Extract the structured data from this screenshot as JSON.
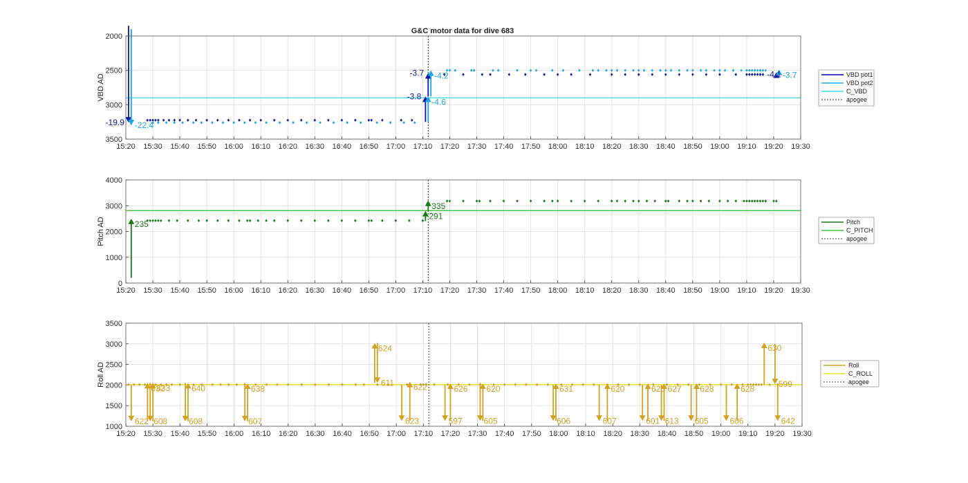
{
  "title": "G&C motor data for dive 683",
  "chart_data": [
    {
      "type": "line",
      "ylabel": "VBD AD",
      "ylim": [
        2000,
        3500
      ],
      "y_reversed": true,
      "yticks": [
        2000,
        2500,
        3000,
        3500
      ],
      "xlim": [
        "15:20",
        "19:30"
      ],
      "xtick_labels": [
        "15:20",
        "15:30",
        "15:40",
        "15:50",
        "16:00",
        "16:10",
        "16:20",
        "16:30",
        "16:40",
        "16:50",
        "17:00",
        "17:10",
        "17:20",
        "17:30",
        "17:40",
        "17:50",
        "18:00",
        "18:10",
        "18:20",
        "18:30",
        "18:40",
        "18:50",
        "19:00",
        "19:10",
        "19:20",
        "19:30"
      ],
      "apogee": "17:12",
      "grid": true,
      "legend": {
        "placement": "right",
        "entries": [
          {
            "label": "VBD pot1",
            "color": "#0000aa",
            "style": "solid"
          },
          {
            "label": "VBD pot2",
            "color": "#1ba6e0",
            "style": "solid"
          },
          {
            "label": "C_VBD",
            "color": "#40d8e8",
            "style": "solid"
          },
          {
            "label": "apogee",
            "color": "#333333",
            "style": "dotted"
          }
        ]
      },
      "reference_line": {
        "name": "C_VBD",
        "value": 2900,
        "color": "#40d8e8"
      },
      "series": [
        {
          "name": "VBD pot1",
          "color": "#0a1aa8",
          "y": 3225,
          "x": [
            "15:28",
            "15:29",
            "15:30",
            "15:31",
            "15:32",
            "15:34",
            "15:36",
            "15:38",
            "15:40",
            "15:43",
            "15:46",
            "15:50",
            "15:54",
            "15:58",
            "16:02",
            "16:06",
            "16:10",
            "16:15",
            "16:20",
            "16:25",
            "16:30",
            "16:35",
            "16:40",
            "16:45",
            "16:50",
            "16:51",
            "16:55",
            "17:02",
            "17:06"
          ]
        },
        {
          "name": "VBD pot2",
          "color": "#1ba6e0",
          "y": 3260,
          "x": [
            "15:30",
            "15:32",
            "15:35",
            "15:38",
            "15:41",
            "15:45",
            "15:48",
            "15:52",
            "15:56",
            "16:00",
            "16:04",
            "16:08",
            "16:12",
            "16:17",
            "16:22",
            "16:27",
            "16:32",
            "16:37",
            "16:42",
            "16:47",
            "16:53",
            "16:58",
            "17:03",
            "17:07"
          ]
        },
        {
          "name": "VBD pot1",
          "color": "#0a1aa8",
          "y": 2560,
          "x": [
            "17:18",
            "17:25",
            "17:32",
            "17:35",
            "17:42",
            "17:48",
            "17:55",
            "18:00",
            "18:05",
            "18:12",
            "18:20",
            "18:25",
            "18:30",
            "18:35",
            "18:40",
            "18:45",
            "18:50",
            "18:55",
            "19:00",
            "19:06",
            "19:10",
            "19:11",
            "19:12",
            "19:13",
            "19:14",
            "19:15",
            "19:16",
            "19:21"
          ]
        },
        {
          "name": "VBD pot2",
          "color": "#1ba6e0",
          "y": 2500,
          "x": [
            "17:19",
            "17:20",
            "17:22",
            "17:28",
            "17:29",
            "17:36",
            "17:38",
            "17:45",
            "17:50",
            "17:52",
            "17:58",
            "18:02",
            "18:08",
            "18:13",
            "18:15",
            "18:18",
            "18:20",
            "18:22",
            "18:25",
            "18:28",
            "18:30",
            "18:32",
            "18:35",
            "18:38",
            "18:40",
            "18:42",
            "18:45",
            "18:48",
            "18:50",
            "18:53",
            "18:55",
            "18:58",
            "19:00",
            "19:02",
            "19:05",
            "19:08",
            "19:10",
            "19:11",
            "19:12",
            "19:13",
            "19:14",
            "19:15",
            "19:16",
            "19:17"
          ]
        }
      ],
      "events": [
        {
          "series": "VBD pot1",
          "x": "15:21",
          "from": 1850,
          "to": 3260,
          "label": "-19.9",
          "color": "#0a1aa8"
        },
        {
          "series": "VBD pot2",
          "x": "15:22",
          "from": 1900,
          "to": 3300,
          "label": "-22.4",
          "color": "#1ba6e0"
        },
        {
          "series": "VBD pot1",
          "x": "17:11",
          "from": 3250,
          "to": 2880,
          "label": "-3.8",
          "color": "#0a1aa8"
        },
        {
          "series": "VBD pot2",
          "x": "17:12",
          "from": 3250,
          "to": 2880,
          "label": "-4.6",
          "color": "#1ba6e0"
        },
        {
          "series": "VBD pot1",
          "x": "17:12",
          "from": 2880,
          "to": 2540,
          "label": "-3.7",
          "color": "#0a1aa8"
        },
        {
          "series": "VBD pot2",
          "x": "17:13",
          "from": 2880,
          "to": 2500,
          "label": "-4.2",
          "color": "#1ba6e0"
        },
        {
          "series": "VBD pot1",
          "x": "19:21",
          "from": 2560,
          "to": 2530,
          "label": "",
          "color": "#0a1aa8"
        },
        {
          "series": "VBD pot2",
          "x": "19:22",
          "from": 2560,
          "to": 2490,
          "label": "-3.7",
          "color": "#1ba6e0"
        }
      ],
      "extra_labels": [
        {
          "x": "19:17",
          "y": 2560,
          "text": "-4.1",
          "color": "#0a1aa8"
        }
      ]
    },
    {
      "type": "line",
      "ylabel": "Pitch AD",
      "ylim": [
        0,
        4000
      ],
      "y_reversed": false,
      "yticks": [
        0,
        1000,
        2000,
        3000,
        4000
      ],
      "xlim": [
        "15:20",
        "19:30"
      ],
      "xtick_labels": [
        "15:20",
        "15:30",
        "15:40",
        "15:50",
        "16:00",
        "16:10",
        "16:20",
        "16:30",
        "16:40",
        "16:50",
        "17:00",
        "17:10",
        "17:20",
        "17:30",
        "17:40",
        "17:50",
        "18:00",
        "18:10",
        "18:20",
        "18:30",
        "18:40",
        "18:50",
        "19:00",
        "19:10",
        "19:20",
        "19:30"
      ],
      "apogee": "17:12",
      "grid": true,
      "legend": {
        "placement": "right",
        "entries": [
          {
            "label": "Pitch",
            "color": "#1a7a1a",
            "style": "solid"
          },
          {
            "label": "C_PITCH",
            "color": "#3cc43c",
            "style": "solid"
          },
          {
            "label": "apogee",
            "color": "#333333",
            "style": "dotted"
          }
        ]
      },
      "reference_line": {
        "name": "C_PITCH",
        "value": 2810,
        "color": "#3cc43c"
      },
      "series": [
        {
          "name": "Pitch",
          "color": "#1a7a1a",
          "y": 2420,
          "x": [
            "15:28",
            "15:29",
            "15:30",
            "15:31",
            "15:32",
            "15:33",
            "15:36",
            "15:39",
            "15:43",
            "15:47",
            "15:50",
            "15:54",
            "15:58",
            "16:02",
            "16:05",
            "16:06",
            "16:09",
            "16:12",
            "16:15",
            "16:20",
            "16:25",
            "16:30",
            "16:35",
            "16:40",
            "16:45",
            "16:50",
            "16:51",
            "16:55",
            "17:00",
            "17:05",
            "17:10"
          ]
        },
        {
          "name": "Pitch",
          "color": "#1a7a1a",
          "y": 3180,
          "x": [
            "17:19",
            "17:20",
            "17:25",
            "17:30",
            "17:31",
            "17:35",
            "17:40",
            "17:45",
            "17:50",
            "17:55",
            "17:58",
            "18:00",
            "18:05",
            "18:10",
            "18:15",
            "18:20",
            "18:22",
            "18:25",
            "18:28",
            "18:30",
            "18:33",
            "18:36",
            "18:40",
            "18:41",
            "18:45",
            "18:48",
            "18:50",
            "18:53",
            "18:56",
            "19:00",
            "19:03",
            "19:06",
            "19:09",
            "19:10",
            "19:11",
            "19:12",
            "19:13",
            "19:14",
            "19:15",
            "19:16",
            "19:17",
            "19:20",
            "19:21"
          ]
        }
      ],
      "events": [
        {
          "x": "15:22",
          "from": 200,
          "to": 2500,
          "label": "235",
          "color": "#1a7a1a"
        },
        {
          "x": "17:11",
          "from": 2400,
          "to": 2800,
          "label": "291",
          "color": "#1a7a1a"
        },
        {
          "x": "17:12",
          "from": 2800,
          "to": 3200,
          "label": "335",
          "color": "#1a7a1a"
        }
      ]
    },
    {
      "type": "line",
      "ylabel": "Roll AD",
      "ylim": [
        1000,
        3500
      ],
      "y_reversed": false,
      "yticks": [
        1000,
        1500,
        2000,
        2500,
        3000,
        3500
      ],
      "xlim": [
        "15:20",
        "19:30"
      ],
      "xtick_labels": [
        "15:20",
        "15:30",
        "15:40",
        "15:50",
        "16:00",
        "16:10",
        "16:20",
        "16:30",
        "16:40",
        "16:50",
        "17:00",
        "17:10",
        "17:20",
        "17:30",
        "17:40",
        "17:50",
        "18:00",
        "18:10",
        "18:20",
        "18:30",
        "18:40",
        "18:50",
        "19:00",
        "19:10",
        "19:20",
        "19:30"
      ],
      "apogee": "17:12",
      "grid": true,
      "legend": {
        "placement": "right",
        "entries": [
          {
            "label": "Roll",
            "color": "#d4a020",
            "style": "solid"
          },
          {
            "label": "C_ROLL",
            "color": "#f0e020",
            "style": "solid"
          },
          {
            "label": "apogee",
            "color": "#333333",
            "style": "dotted"
          }
        ]
      },
      "reference_line": {
        "name": "C_ROLL",
        "value": 2010,
        "color": "#f0e020"
      },
      "series": [
        {
          "name": "Roll",
          "color": "#c8a030",
          "y": 2010,
          "x": [
            "15:21",
            "15:23",
            "15:25",
            "15:27",
            "15:29",
            "15:31",
            "15:33",
            "15:35",
            "15:37",
            "15:40",
            "15:45",
            "15:48",
            "15:52",
            "15:55",
            "15:58",
            "16:01",
            "16:04",
            "16:08",
            "16:12",
            "16:16",
            "16:20",
            "16:25",
            "16:30",
            "16:35",
            "16:40",
            "16:45",
            "16:48",
            "16:53",
            "16:57",
            "17:04",
            "17:09",
            "17:10",
            "17:11",
            "17:14",
            "17:19",
            "17:23",
            "17:27",
            "17:31",
            "17:36",
            "17:40",
            "17:44",
            "17:48",
            "17:52",
            "17:56",
            "18:01",
            "18:05",
            "18:09",
            "18:13",
            "18:18",
            "18:22",
            "18:26",
            "18:30",
            "18:35",
            "18:40",
            "18:44",
            "18:48",
            "18:52",
            "18:56",
            "19:00",
            "19:04",
            "19:08",
            "19:10",
            "19:11",
            "19:12",
            "19:13",
            "19:14",
            "19:15",
            "19:18",
            "19:21"
          ]
        }
      ],
      "events": [
        {
          "x": "15:22",
          "from": 2000,
          "to": 1120,
          "label": "622"
        },
        {
          "x": "15:28",
          "from": 1120,
          "to": 2050,
          "label": "632"
        },
        {
          "x": "15:29",
          "from": 2050,
          "to": 1120,
          "label": "608"
        },
        {
          "x": "15:30",
          "from": 1120,
          "to": 2060,
          "label": "633"
        },
        {
          "x": "15:42",
          "from": 2050,
          "to": 1120,
          "label": "608"
        },
        {
          "x": "15:43",
          "from": 1120,
          "to": 2050,
          "label": "640"
        },
        {
          "x": "16:04",
          "from": 2050,
          "to": 1120,
          "label": "607"
        },
        {
          "x": "16:05",
          "from": 1120,
          "to": 2040,
          "label": "638"
        },
        {
          "x": "16:52",
          "from": 2050,
          "to": 3020,
          "label": "624"
        },
        {
          "x": "16:53",
          "from": 3020,
          "to": 2050,
          "label": "611"
        },
        {
          "x": "17:02",
          "from": 2000,
          "to": 1130,
          "label": "623"
        },
        {
          "x": "17:05",
          "from": 1130,
          "to": 2080,
          "label": "622"
        },
        {
          "x": "17:18",
          "from": 2000,
          "to": 1130,
          "label": "597"
        },
        {
          "x": "17:20",
          "from": 1130,
          "to": 2040,
          "label": "626"
        },
        {
          "x": "17:31",
          "from": 2050,
          "to": 1130,
          "label": "605"
        },
        {
          "x": "17:32",
          "from": 1130,
          "to": 2040,
          "label": "620"
        },
        {
          "x": "17:58",
          "from": 2000,
          "to": 1130,
          "label": "606"
        },
        {
          "x": "17:59",
          "from": 1130,
          "to": 2040,
          "label": "631"
        },
        {
          "x": "18:15",
          "from": 2000,
          "to": 1130,
          "label": "607"
        },
        {
          "x": "18:18",
          "from": 1130,
          "to": 2040,
          "label": "620"
        },
        {
          "x": "18:31",
          "from": 2000,
          "to": 1130,
          "label": "601"
        },
        {
          "x": "18:33",
          "from": 1130,
          "to": 2040,
          "label": "625"
        },
        {
          "x": "18:38",
          "from": 2000,
          "to": 1130,
          "label": "613"
        },
        {
          "x": "18:39",
          "from": 1130,
          "to": 2040,
          "label": "627"
        },
        {
          "x": "18:49",
          "from": 2000,
          "to": 1130,
          "label": "605"
        },
        {
          "x": "18:51",
          "from": 1130,
          "to": 2040,
          "label": "628"
        },
        {
          "x": "19:02",
          "from": 2000,
          "to": 1130,
          "label": "606"
        },
        {
          "x": "19:06",
          "from": 1130,
          "to": 2040,
          "label": "628"
        },
        {
          "x": "19:16",
          "from": 2000,
          "to": 3030,
          "label": "630"
        },
        {
          "x": "19:20",
          "from": 3000,
          "to": 2020,
          "label": "599"
        },
        {
          "x": "19:21",
          "from": 2020,
          "to": 1130,
          "label": "642"
        }
      ]
    }
  ]
}
